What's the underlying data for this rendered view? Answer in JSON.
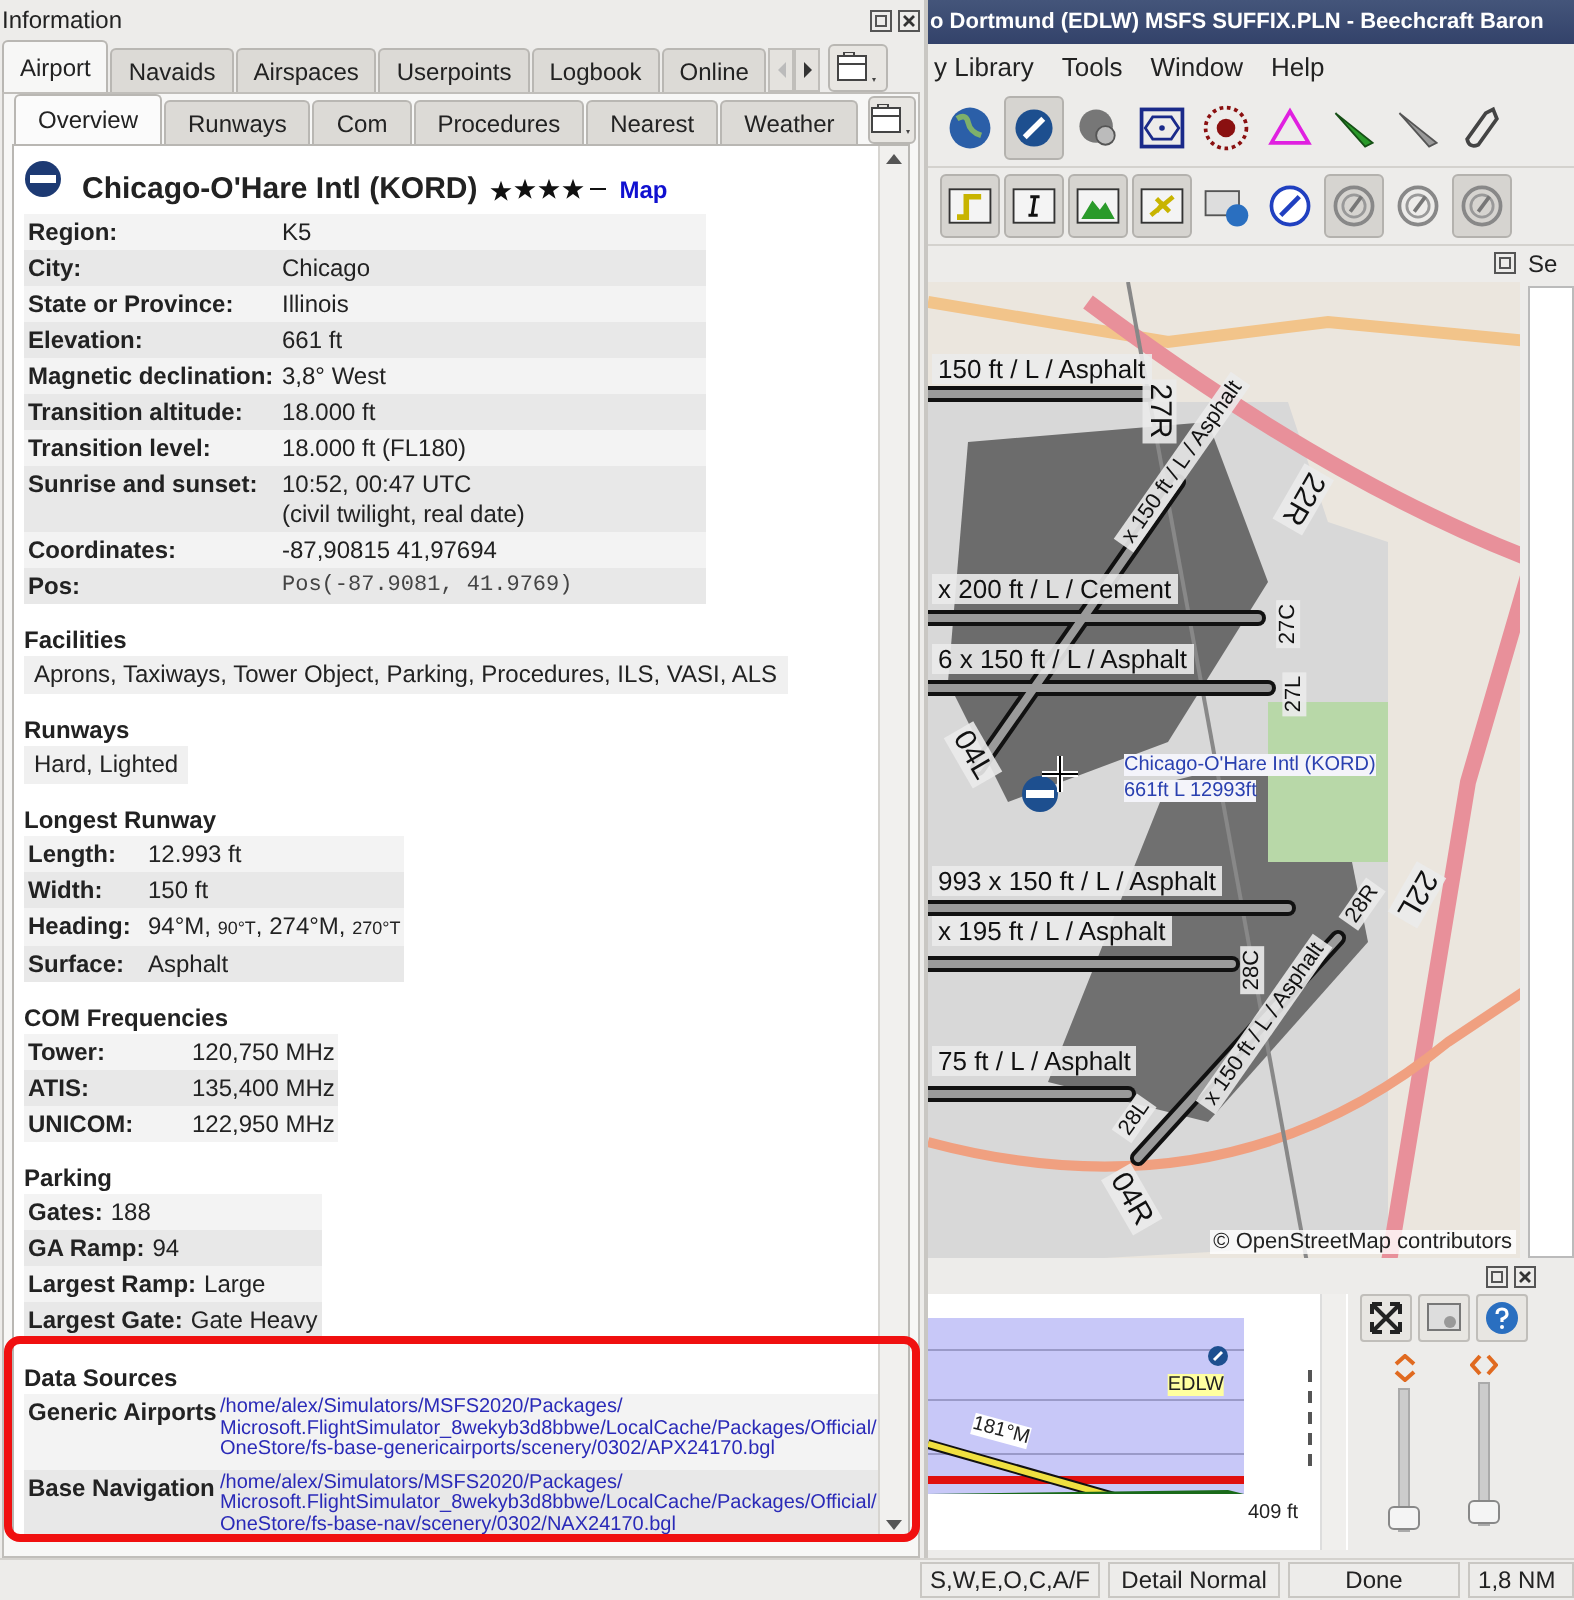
{
  "info_panel": {
    "title": "Information",
    "tabs": [
      {
        "label": "Airport",
        "selected": true
      },
      {
        "label": "Navaids",
        "selected": false
      },
      {
        "label": "Airspaces",
        "selected": false
      },
      {
        "label": "Userpoints",
        "selected": false
      },
      {
        "label": "Logbook",
        "selected": false
      },
      {
        "label": "Online",
        "selected": false
      }
    ],
    "subtabs": [
      {
        "label": "Overview",
        "selected": true
      },
      {
        "label": "Runways",
        "selected": false
      },
      {
        "label": "Com",
        "selected": false
      },
      {
        "label": "Procedures",
        "selected": false
      },
      {
        "label": "Nearest",
        "selected": false
      },
      {
        "label": "Weather",
        "selected": false
      }
    ],
    "airport": {
      "name": "Chicago-O'Hare Intl (KORD)",
      "stars": 4,
      "link": "Map"
    },
    "details": [
      {
        "label": "Region:",
        "value": "K5",
        "kind": "text"
      },
      {
        "label": "City:",
        "value": "Chicago",
        "kind": "text"
      },
      {
        "label": "State or Province:",
        "value": "Illinois",
        "kind": "text"
      },
      {
        "label": "Elevation:",
        "value": "661 ft",
        "kind": "text"
      },
      {
        "label": "Magnetic declination:",
        "value": "3,8° West",
        "kind": "text"
      },
      {
        "label": "Transition altitude:",
        "value": "18.000 ft",
        "kind": "text"
      },
      {
        "label": "Transition level:",
        "value": "18.000 ft (FL180)",
        "kind": "text"
      },
      {
        "label": "Sunrise and sunset:",
        "value": "10:52, 00:47 UTC",
        "note": "(civil twilight, real date)",
        "kind": "text"
      },
      {
        "label": "Coordinates:",
        "value": "-87,90815 41,97694",
        "kind": "text"
      },
      {
        "label": "Pos:",
        "value": "Pos(-87.9081, 41.9769)",
        "kind": "mono"
      }
    ],
    "sections": [
      {
        "title": "Facilities",
        "text": "Aprons, Taxiways, Tower Object, Parking, Procedures, ILS, VASI, ALS"
      },
      {
        "title": "Runways",
        "text": "Hard, Lighted"
      },
      {
        "title": "Longest Runway",
        "rows": [
          {
            "label": "Length:",
            "parts": [
              {
                "text": "12.993 ft",
                "small": false
              }
            ]
          },
          {
            "label": "Width:",
            "parts": [
              {
                "text": "150 ft",
                "small": false
              }
            ]
          },
          {
            "label": "Heading:",
            "parts": [
              {
                "text": "94°M, ",
                "small": false
              },
              {
                "text": "90°T",
                "small": true
              },
              {
                "text": ", 274°M, ",
                "small": false
              },
              {
                "text": "270°T",
                "small": true
              }
            ]
          },
          {
            "label": "Surface:",
            "parts": [
              {
                "text": "Asphalt",
                "small": false
              }
            ]
          }
        ]
      },
      {
        "title": "COM Frequencies",
        "rows": [
          {
            "label": "Tower:",
            "parts": [
              {
                "text": "120,750 MHz",
                "small": false
              }
            ]
          },
          {
            "label": "ATIS:",
            "parts": [
              {
                "text": "135,400 MHz",
                "small": false
              }
            ]
          },
          {
            "label": "UNICOM:",
            "parts": [
              {
                "text": "122,950 MHz",
                "small": false
              }
            ]
          }
        ]
      },
      {
        "title": "Parking",
        "rows": [
          {
            "label": "Gates:",
            "parts": [
              {
                "text": "188",
                "small": false
              }
            ]
          },
          {
            "label": "GA Ramp:",
            "parts": [
              {
                "text": "94",
                "small": false
              }
            ]
          },
          {
            "label": "Largest Ramp:",
            "parts": [
              {
                "text": "Large",
                "small": false
              }
            ]
          },
          {
            "label": "Largest Gate:",
            "parts": [
              {
                "text": "Gate Heavy",
                "small": false
              }
            ]
          }
        ]
      }
    ],
    "data_sources": {
      "title": "Data Sources",
      "rows": [
        {
          "label": "Generic Airports",
          "path": "/home/alex/Simulators/MSFS2020/Packages/Microsoft.FlightSimulator_8wekyb3d8bbwe/LocalCache/Packages/Official/OneStore/fs-base-genericairports/scenery/0302/APX24170.bgl"
        },
        {
          "label": "Base Navigation",
          "path": "/home/alex/Simulators/MSFS2020/Packages/Microsoft.FlightSimulator_8wekyb3d8bbwe/LocalCache/Packages/Official/OneStore/fs-base-nav/scenery/0302/NAX24170.bgl"
        }
      ]
    }
  },
  "window": {
    "title": "o Dortmund (EDLW) MSFS SUFFIX.PLN - Beechcraft Baron",
    "menu": [
      "y Library",
      "Tools",
      "Window",
      "Help"
    ],
    "toolbar_1": [
      {
        "kind": "globe",
        "pressed": false
      },
      {
        "kind": "airport",
        "pressed": true
      },
      {
        "kind": "gear-globe",
        "pressed": false
      },
      {
        "kind": "vor",
        "pressed": false
      },
      {
        "kind": "ndb",
        "pressed": false
      },
      {
        "kind": "triangle",
        "pressed": false
      },
      {
        "kind": "green-pin",
        "pressed": false
      },
      {
        "kind": "grey-pin",
        "pressed": false
      },
      {
        "kind": "hook",
        "pressed": false
      }
    ],
    "toolbar_2": [
      {
        "kind": "route",
        "pressed": true
      },
      {
        "kind": "text",
        "pressed": true
      },
      {
        "kind": "terrain",
        "pressed": true
      },
      {
        "kind": "plane",
        "pressed": true
      },
      {
        "kind": "info",
        "pressed": false
      },
      {
        "kind": "compass",
        "pressed": false
      },
      {
        "kind": "airspace",
        "pressed": true
      },
      {
        "kind": "airspace",
        "pressed": false
      },
      {
        "kind": "airspace",
        "pressed": true
      }
    ]
  },
  "map": {
    "labels": [
      {
        "text": "150 ft / L / Asphalt",
        "kind": "info"
      },
      {
        "text": "x 200 ft / L / Cement",
        "kind": "info"
      },
      {
        "text": "6 x 150 ft / L / Asphalt",
        "kind": "info"
      },
      {
        "text": "993 x 150 ft / L / Asphalt",
        "kind": "info"
      },
      {
        "text": "x 195 ft / L / Asphalt",
        "kind": "info"
      },
      {
        "text": "75 ft / L / Asphalt",
        "kind": "info"
      },
      {
        "text": "x 150 ft / L / Asphalt",
        "kind": "info"
      },
      {
        "text": "x 150 ft / L / Asphalt",
        "kind": "info"
      },
      {
        "text": "27R",
        "kind": "end"
      },
      {
        "text": "22R",
        "kind": "end"
      },
      {
        "text": "27C",
        "kind": "end"
      },
      {
        "text": "27L",
        "kind": "end"
      },
      {
        "text": "04L",
        "kind": "end"
      },
      {
        "text": "22L",
        "kind": "end"
      },
      {
        "text": "28R",
        "kind": "end"
      },
      {
        "text": "28C",
        "kind": "end"
      },
      {
        "text": "28L",
        "kind": "end"
      },
      {
        "text": "04R",
        "kind": "end"
      },
      {
        "text": "Chicago-O'Hare Intl (KORD)",
        "kind": "airport"
      },
      {
        "text": "661ft L 12993ft",
        "kind": "airport"
      }
    ],
    "attribution": "© OpenStreetMap contributors"
  },
  "side_panel": {
    "title": "Se"
  },
  "profile": {
    "airport": "EDLW",
    "course": "181°M",
    "altitude": "409 ft",
    "sliders": [
      {
        "level": 0
      },
      {
        "level": 0
      }
    ]
  },
  "status_bar": [
    "S,W,E,O,C,A/F",
    "Detail Normal",
    "Done",
    "1,8 NM"
  ]
}
